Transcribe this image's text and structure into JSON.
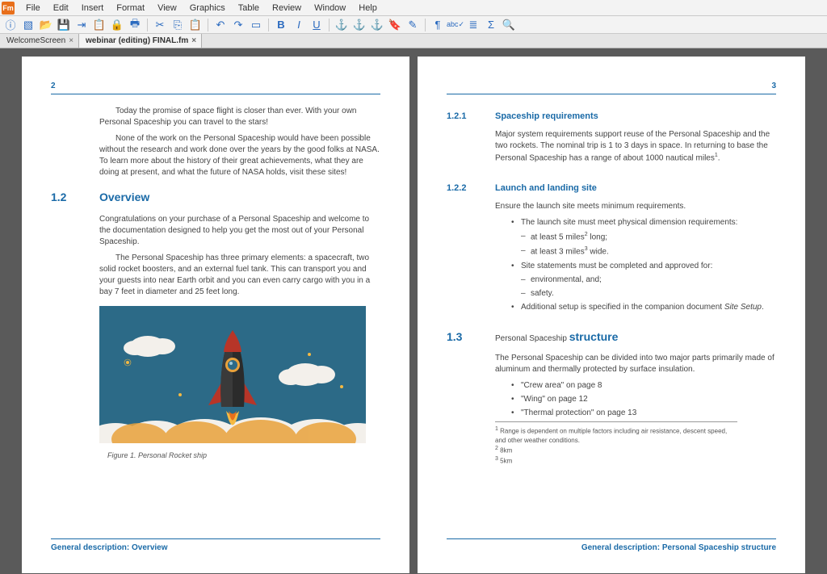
{
  "app_label": "Fm",
  "menubar": [
    "File",
    "Edit",
    "Insert",
    "Format",
    "View",
    "Graphics",
    "Table",
    "Review",
    "Window",
    "Help"
  ],
  "toolbar_icons": [
    "info",
    "new",
    "open",
    "save",
    "import",
    "clipboard",
    "lock",
    "print",
    "cut",
    "copy",
    "clipboard2",
    "undo",
    "redo",
    "group",
    "bold",
    "italic",
    "underline",
    "anchor",
    "anchor-broken",
    "anchor-link",
    "bookmark",
    "wand",
    "paragraph",
    "spellcheck",
    "list",
    "sigma",
    "search"
  ],
  "tabs": [
    {
      "label": "WelcomeScreen",
      "close": "×"
    },
    {
      "label": "webinar (editing) FINAL.fm",
      "close": "×"
    }
  ],
  "left_page": {
    "number": "2",
    "intro1": "Today the promise of space flight is closer than ever. With your own Personal Spaceship you can travel to the stars!",
    "intro2": "None of the work on the Personal Spaceship would have been possible without the research and work done over the years by the good folks at NASA. To learn more about the history of their great achievements, what they are doing at present, and what the future of NASA holds, visit these sites!",
    "h_num": "1.2",
    "h_label": "Overview",
    "body1": "Congratulations on your purchase of a Personal Spaceship and welcome to the documentation designed to help you get the most out of your Personal Spaceship.",
    "body2": "The Personal Spaceship has three primary elements: a spacecraft, two solid rocket boosters, and an external fuel tank. This can transport you and your guests into near Earth orbit and you can even carry cargo with you in a bay 7 feet in diameter and 25 feet long.",
    "figure_caption": "Figure 1. Personal Rocket ship",
    "footer": "General description: Overview"
  },
  "right_page": {
    "number": "3",
    "s1_num": "1.2.1",
    "s1_label": "Spaceship requirements",
    "s1_body": "Major system requirements support reuse of the Personal Spaceship and the two rockets. The nominal trip is 1 to 3 days in space. In returning to base the Personal Spaceship has a range of about 1000 nautical miles",
    "s1_sup": "1",
    "s1_period": ".",
    "s2_num": "1.2.2",
    "s2_label": "Launch and landing site",
    "s2_body": "Ensure the launch site meets minimum requirements.",
    "bul1": "The launch site must meet physical dimension requirements:",
    "bul1a_a": "at least 5 miles",
    "bul1a_sup": "2",
    "bul1a_b": " long;",
    "bul1b_a": "at least 3 miles",
    "bul1b_sup": "3",
    "bul1b_b": " wide.",
    "bul2": "Site statements must be completed and approved for:",
    "bul2a": "environmental, and;",
    "bul2b": "safety.",
    "bul3_a": "Additional setup is specified in the companion document ",
    "bul3_i": "Site Setup",
    "bul3_b": ".",
    "h_num": "1.3",
    "h_pre": "Personal Spaceship ",
    "h_label": "structure",
    "body1": "The Personal Spaceship can be divided into two major parts primarily made of aluminum and thermally protected by surface insulation.",
    "link1": "\"Crew area\" on page 8",
    "link2": "\"Wing\" on page 12",
    "link3": "\"Thermal protection\" on page 13",
    "fn1_sup": "1",
    "fn1": " Range is dependent on multiple factors including air resistance, descent speed, and other weather conditions.",
    "fn2_sup": "2",
    "fn2": " 8km",
    "fn3_sup": "3",
    "fn3": " 5km",
    "footer": "General description: Personal Spaceship structure"
  }
}
